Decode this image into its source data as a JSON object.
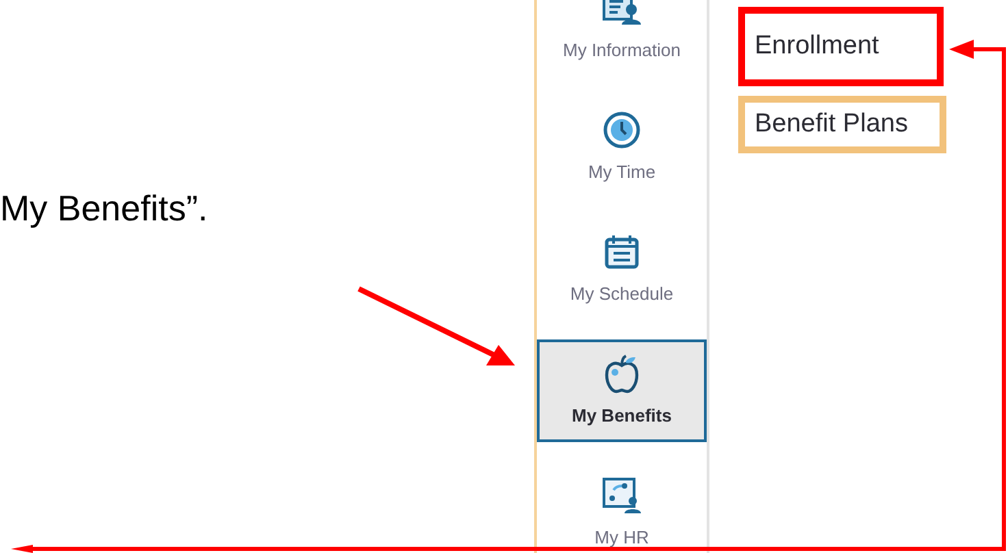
{
  "slide_text": "My Benefits”.",
  "nav_items": [
    {
      "label": "My Information",
      "selected": false
    },
    {
      "label": "My Time",
      "selected": false
    },
    {
      "label": "My Schedule",
      "selected": false
    },
    {
      "label": "My Benefits",
      "selected": true
    },
    {
      "label": "My HR",
      "selected": false
    }
  ],
  "submenu": [
    {
      "label": "Enrollment",
      "color": "#ff0000"
    },
    {
      "label": "Benefit Plans",
      "color": "#f2c27c"
    }
  ]
}
